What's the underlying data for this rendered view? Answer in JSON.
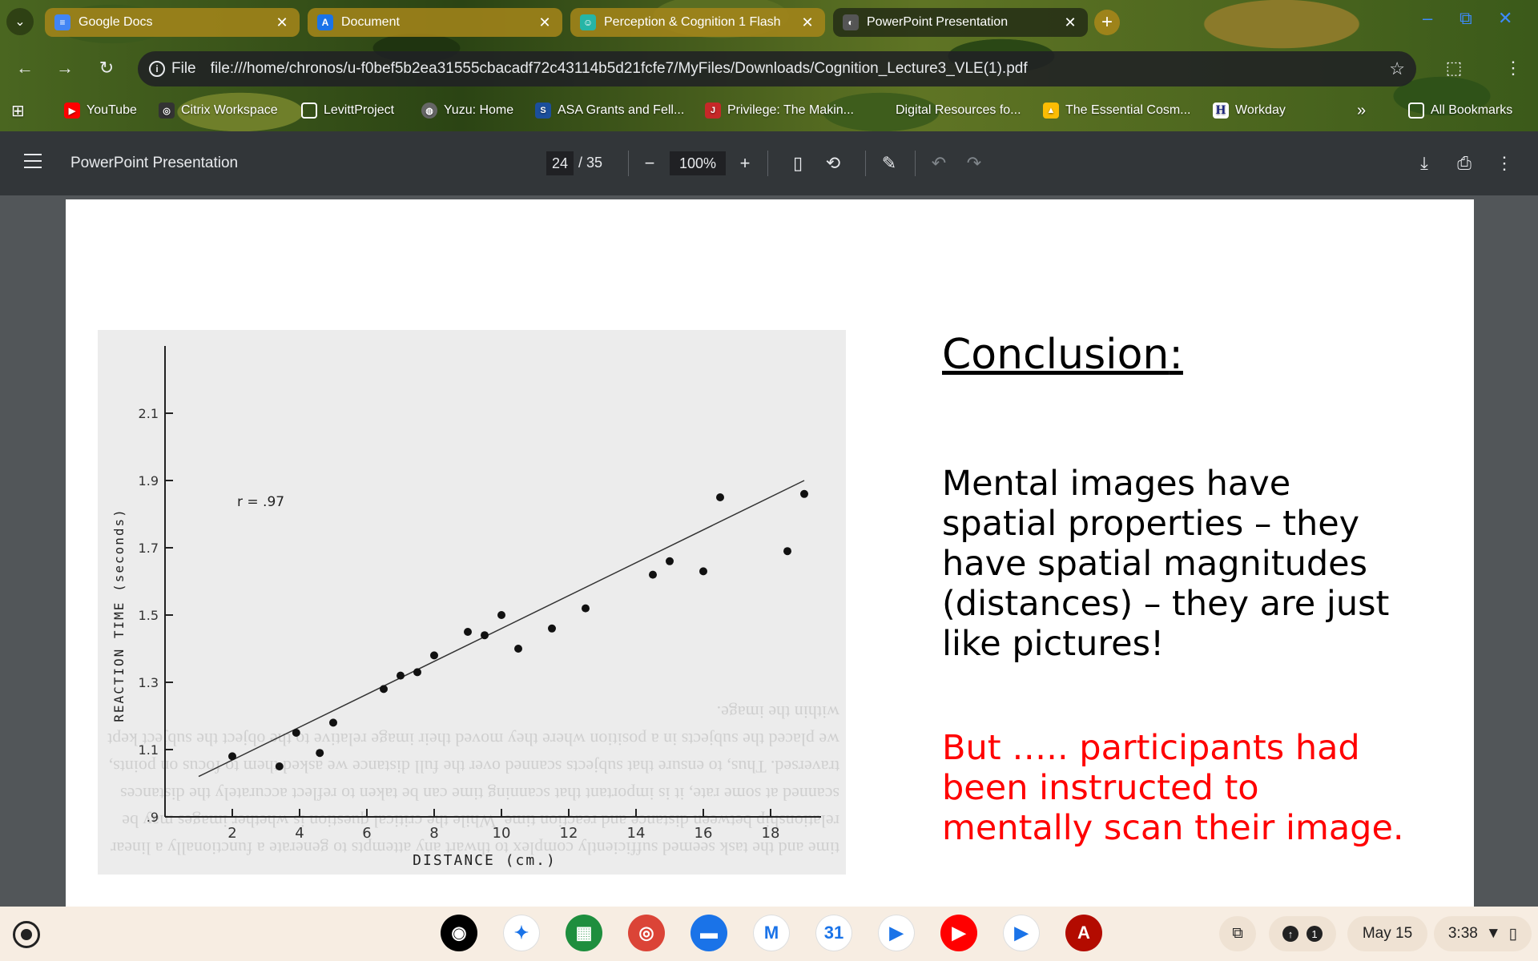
{
  "tabs": [
    {
      "title": "Google Docs",
      "favicon": "docs-icon",
      "color": "#4285f4"
    },
    {
      "title": "Document",
      "favicon": "doc-a-icon",
      "color": "#1a73e8"
    },
    {
      "title": "Perception & Cognition 1 Flash",
      "favicon": "flashcard-icon",
      "color": "#26b5a6"
    },
    {
      "title": "PowerPoint Presentation",
      "favicon": "pdf-tab-icon",
      "color": "#555555"
    }
  ],
  "address_bar": {
    "scheme_label": "File",
    "url": "file:///home/chronos/u-f0bef5b2ea31555cbacadf72c43114b5d21fcfe7/MyFiles/Downloads/Cognition_Lecture3_VLE(1).pdf"
  },
  "bookmarks": [
    {
      "label": "YouTube",
      "icon": "youtube-icon"
    },
    {
      "label": "Citrix Workspace",
      "icon": "citrix-icon"
    },
    {
      "label": "LevittProject",
      "icon": "folder-icon"
    },
    {
      "label": "Yuzu: Home",
      "icon": "globe-icon"
    },
    {
      "label": "ASA Grants and Fell...",
      "icon": "asa-icon"
    },
    {
      "label": "Privilege: The Makin...",
      "icon": "book-icon"
    },
    {
      "label": "Digital Resources fo...",
      "icon": "page-icon"
    },
    {
      "label": "The Essential Cosm...",
      "icon": "drive-icon"
    },
    {
      "label": "Workday",
      "icon": "workday-icon"
    }
  ],
  "all_bookmarks_label": "All Bookmarks",
  "pdf_toolbar": {
    "title": "PowerPoint Presentation",
    "current_page": "24",
    "total_pages": "/ 35",
    "zoom": "100%"
  },
  "slide": {
    "heading": "Conclusion",
    "heading_colon": ":",
    "body": "Mental images have spatial properties – they have spatial magnitudes (distances) – they are just like pictures!",
    "red_text": "But ….. participants had been instructed to mentally scan their image.",
    "red_color": "#ff0000"
  },
  "chart_data": {
    "type": "scatter",
    "xlabel": "DISTANCE (cm.)",
    "ylabel": "REACTION TIME (seconds)",
    "annotation": "r = .97",
    "x_ticks": [
      "2",
      "4",
      "6",
      "8",
      "10",
      "12",
      "14",
      "16",
      "18"
    ],
    "y_ticks": [
      ".9",
      "1.1",
      "1.3",
      "1.5",
      "1.7",
      "1.9",
      "2.1"
    ],
    "xlim": [
      0,
      19
    ],
    "ylim": [
      0.9,
      2.2
    ],
    "points": [
      {
        "x": 2.0,
        "y": 1.08
      },
      {
        "x": 3.4,
        "y": 1.05
      },
      {
        "x": 3.9,
        "y": 1.15
      },
      {
        "x": 4.6,
        "y": 1.09
      },
      {
        "x": 5.0,
        "y": 1.18
      },
      {
        "x": 6.5,
        "y": 1.28
      },
      {
        "x": 7.0,
        "y": 1.32
      },
      {
        "x": 7.5,
        "y": 1.33
      },
      {
        "x": 8.0,
        "y": 1.38
      },
      {
        "x": 9.0,
        "y": 1.45
      },
      {
        "x": 9.5,
        "y": 1.44
      },
      {
        "x": 10.0,
        "y": 1.5
      },
      {
        "x": 10.5,
        "y": 1.4
      },
      {
        "x": 11.5,
        "y": 1.46
      },
      {
        "x": 12.5,
        "y": 1.52
      },
      {
        "x": 14.5,
        "y": 1.62
      },
      {
        "x": 15.0,
        "y": 1.66
      },
      {
        "x": 16.0,
        "y": 1.63
      },
      {
        "x": 16.5,
        "y": 1.85
      },
      {
        "x": 18.5,
        "y": 1.69
      },
      {
        "x": 19.0,
        "y": 1.86
      }
    ],
    "fit_line": {
      "x0": 1.0,
      "y0": 1.02,
      "x1": 19.0,
      "y1": 1.9
    },
    "grid": false
  },
  "figure_background_text": "time and the task seemed sufficiently complex to thwart any attempts to generate a functionally a linear relationship between distance and reaction time. While the critical question is whether images may be scanned at some rate, it is important that scanning time can be taken to reflect accurately the distances traversed. Thus, to ensure that subjects scanned over the full distance we asked them to focus on points, we placed the subjects in a position where they moved their image relative to the object the subject kept within the image.",
  "shelf": {
    "apps": [
      {
        "name": "podcasts-app",
        "color": "#000000",
        "glyph": "◉"
      },
      {
        "name": "gemini-app",
        "color": "#ffffff",
        "glyph": "✦"
      },
      {
        "name": "app-launcher-grid",
        "color": "#1e8e3e",
        "glyph": "▦"
      },
      {
        "name": "chrome-app",
        "color": "#db4437",
        "glyph": "◎"
      },
      {
        "name": "files-app",
        "color": "#1a73e8",
        "glyph": "▬"
      },
      {
        "name": "gmail-app",
        "color": "#ffffff",
        "glyph": "M"
      },
      {
        "name": "calendar-app",
        "color": "#ffffff",
        "glyph": "31"
      },
      {
        "name": "meet-app",
        "color": "#ffffff",
        "glyph": "▶"
      },
      {
        "name": "youtube-app",
        "color": "#ff0000",
        "glyph": "▶"
      },
      {
        "name": "play-store-app",
        "color": "#ffffff",
        "glyph": "▶"
      },
      {
        "name": "acrobat-app",
        "color": "#b30b00",
        "glyph": "A"
      }
    ],
    "notification_count": "1",
    "date": "May 15",
    "time": "3:38"
  }
}
